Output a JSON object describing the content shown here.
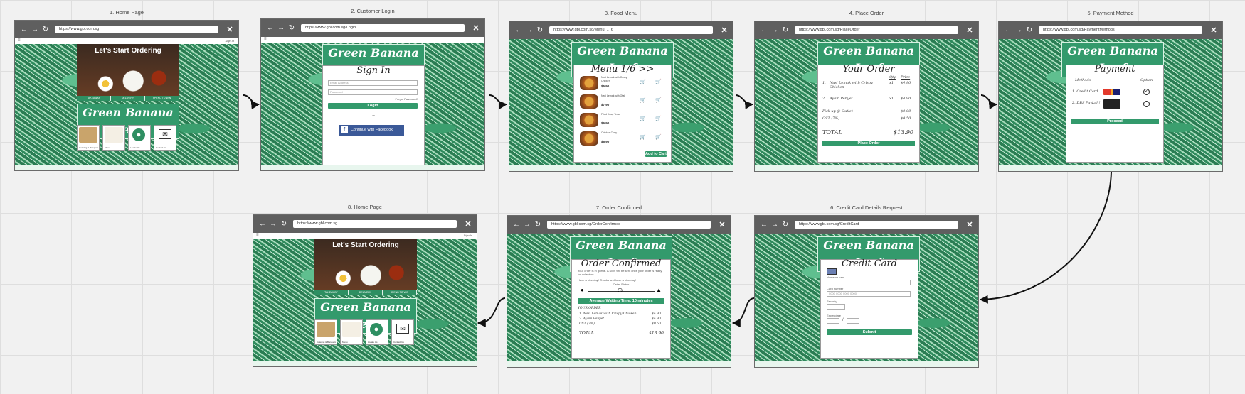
{
  "frames": [
    {
      "id": 1,
      "title": "1. Home Page",
      "url": "https://www.gbl.com.sg"
    },
    {
      "id": 2,
      "title": "2. Customer Login",
      "url": "https://www.gbl.com.sg/Login"
    },
    {
      "id": 3,
      "title": "3. Food Menu",
      "url": "https://www.gbl.com.sg/Menu_1_6"
    },
    {
      "id": 4,
      "title": "4. Place Order",
      "url": "https://www.gbl.com.sg/PlaceOrder"
    },
    {
      "id": 5,
      "title": "5. Payment Method",
      "url": "https://www.gbl.com.sg/PaymentMethods"
    },
    {
      "id": 6,
      "title": "6. Credit Card Details Request",
      "url": "https://www.gbl.com.sg/CreditCard"
    },
    {
      "id": 7,
      "title": "7. Order Confirmed",
      "url": "https://www.gbl.com.sg/OrderConfirmed"
    },
    {
      "id": 8,
      "title": "8. Home Page",
      "url": "https://www.gbl.com.sg"
    }
  ],
  "brand": "Green Banana Leaf",
  "home": {
    "signin": "Sign In",
    "hero_title": "Let's Start Ordering",
    "tabs": [
      "TAKEAWAY",
      "DELIVERY",
      "SPEND TO WIN"
    ],
    "tiles": [
      "Catering & Banquets",
      "Menu",
      "Locate Us",
      "Contact Us"
    ]
  },
  "login": {
    "title": "Sign In",
    "email_placeholder": "Email Address",
    "password_placeholder": "Password",
    "forgot": "Forgot Password?",
    "login_btn": "Login",
    "or": "or",
    "facebook_btn": "Continue with Facebook"
  },
  "menu": {
    "title": "Menu 1/6 >>",
    "items": [
      {
        "desc": "Nasi Lemak with Crispy Chicken",
        "price": "$5.90"
      },
      {
        "desc": "Nasi Lemak with Otah",
        "price": "$7.90"
      },
      {
        "desc": "Fried Kway Teow",
        "price": "$6.90"
      },
      {
        "desc": "Chicken Curry",
        "price": "$6.90"
      }
    ],
    "add_to_cart": "Add to Cart"
  },
  "order": {
    "title": "Your Order",
    "col_qty": "Qty",
    "col_price": "Price",
    "items": [
      {
        "n": "1.",
        "name": "Nasi Lemak with Crispy Chicken",
        "qty": "x1",
        "price": "$4.90"
      },
      {
        "n": "2.",
        "name": "Ayam Penyet",
        "qty": "x1",
        "price": "$4.90"
      }
    ],
    "pickup": "Pick up @ Outlet",
    "pickup_price": "$0.00",
    "gst": "GST (7%)",
    "gst_price": "$0.50",
    "total_label": "TOTAL",
    "total": "$13.90",
    "button": "Place Order"
  },
  "payment": {
    "title": "Payment",
    "col_methods": "Methods",
    "col_option": "Option",
    "methods": [
      "1. Credit Card",
      "2. DBS PayLah!"
    ],
    "button": "Proceed"
  },
  "credit": {
    "title": "Credit Card",
    "name_label": "Name on card",
    "card_label": "Card number",
    "card_placeholder": "0000 0000 0000 0000",
    "cvv_label": "Security",
    "expiry_label": "Expiry date",
    "slash": "/",
    "button": "Submit"
  },
  "confirmed": {
    "title": "Order Confirmed",
    "message": "Your order is in queue. A SMS will be sent once your order is ready for collection.",
    "thanks": "Have a nice day! Thanks and have a nice day!",
    "status_label": "Order Status",
    "wait": "Average Waiting Time: 10 minutes",
    "order_label": "YOUR ORDER",
    "items": [
      {
        "name": "1. Nasi Lemak with Crispy Chicken",
        "price": "$4.90"
      },
      {
        "name": "2. Ayam Penyet",
        "price": "$4.90"
      },
      {
        "name": "GST (7%)",
        "price": "$0.50"
      }
    ],
    "total_label": "TOTAL",
    "total": "$13.90"
  },
  "nav_icons": [
    "back-icon",
    "forward-icon",
    "refresh-icon",
    "close-icon"
  ],
  "colors": {
    "brand_green": "#339a6c",
    "toolbar": "#5f5f5f",
    "canvas": "#f1f1f1"
  }
}
